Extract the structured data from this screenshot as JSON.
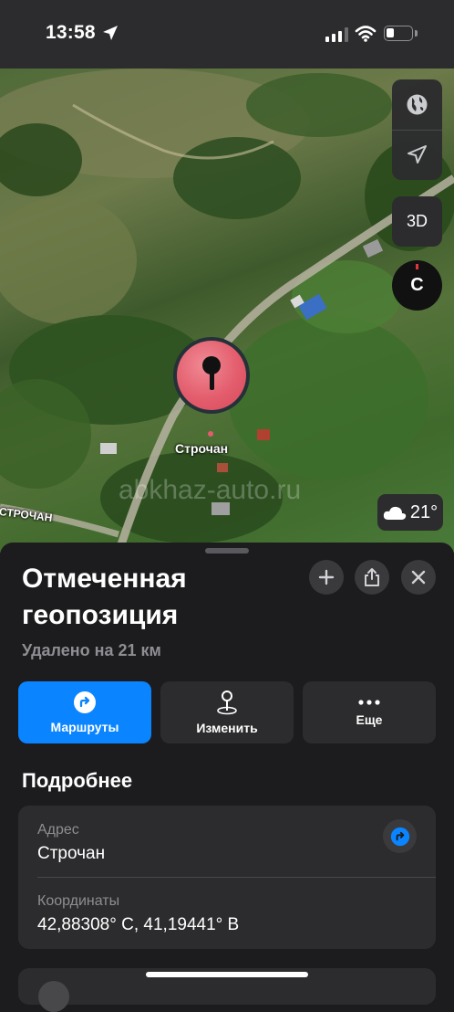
{
  "status_bar": {
    "time": "13:58"
  },
  "map": {
    "pin_label": "Строчан",
    "road_label": "СТРОЧАН",
    "watermark": "abkhaz-auto.ru",
    "btn_3d": "3D",
    "compass_letter": "С",
    "weather_temp": "21°",
    "icons": [
      "globe-icon",
      "location-arrow-icon",
      "cloud-icon"
    ]
  },
  "sheet": {
    "title": "Отмеченная геопозиция",
    "subtitle": "Удалено на 21 км",
    "actions": [
      {
        "label": "Маршруты",
        "icon": "directions-icon"
      },
      {
        "label": "Изменить",
        "icon": "pin-icon"
      },
      {
        "label": "Еще",
        "icon": "more-icon"
      }
    ],
    "details_heading": "Подробнее",
    "address_label": "Адрес",
    "address_value": "Строчан",
    "coords_label": "Координаты",
    "coords_value": "42,88308° С, 41,19441° В"
  },
  "colors": {
    "accent": "#0a84ff",
    "pin": "#e35d6d",
    "sheet_bg": "#1c1c1e",
    "card_bg": "#2c2c2e"
  }
}
